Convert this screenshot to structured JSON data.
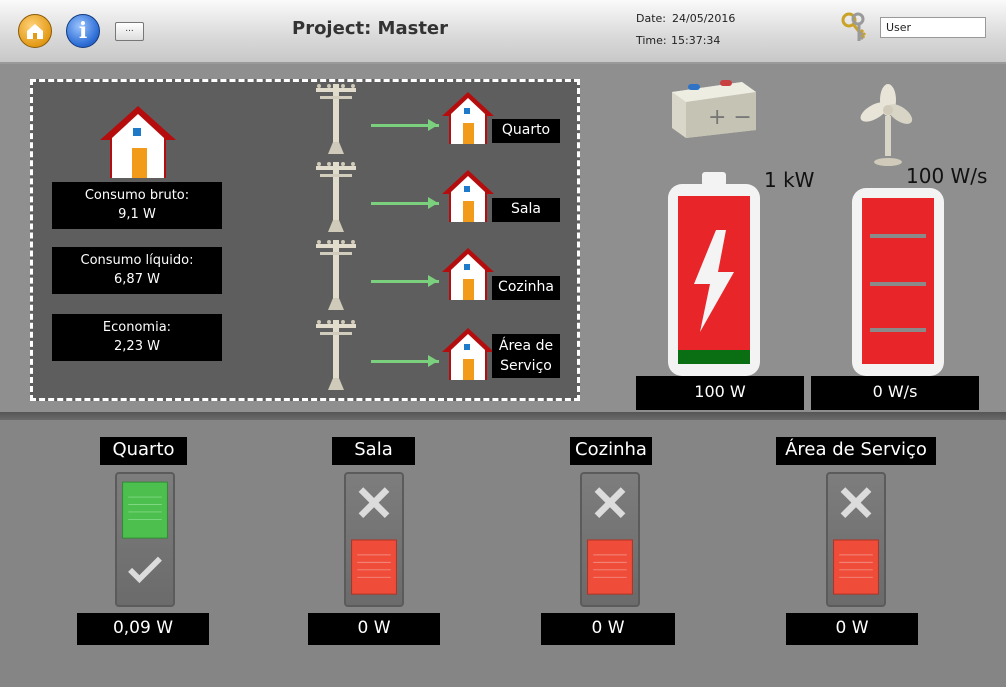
{
  "header": {
    "title": "Project: Master",
    "more_label": "...",
    "info_glyph": "i",
    "date_label": "Date:",
    "date_value": "24/05/2016",
    "time_label": "Time:",
    "time_value": "15:37:34",
    "user_value": "User"
  },
  "summary": [
    {
      "label": "Consumo bruto:",
      "value": "9,1 W"
    },
    {
      "label": "Consumo líquido:",
      "value": "6,87 W"
    },
    {
      "label": "Economia:",
      "value": "2,23 W"
    }
  ],
  "rooms": [
    "Quarto",
    "Sala",
    "Cozinha",
    "Área de Serviço"
  ],
  "room_tags": [
    "Quarto",
    "Sala",
    "Cozinha",
    [
      "Área de",
      "Serviço"
    ]
  ],
  "battery": {
    "capacity": "1 kW",
    "value": "100 W",
    "fill_color": "#e8262a",
    "charge_color": "#0a6e12"
  },
  "fan": {
    "rate": "100 W/s",
    "value": "0 W/s"
  },
  "switches": [
    {
      "room": "Quarto",
      "state": "on",
      "value": "0,09 W"
    },
    {
      "room": "Sala",
      "state": "off",
      "value": "0 W"
    },
    {
      "room": "Cozinha",
      "state": "off",
      "value": "0 W"
    },
    {
      "room": "Área de Serviço",
      "state": "off",
      "value": "0 W"
    }
  ],
  "colors": {
    "on": "#4cbf4e",
    "off": "#ef4c3a",
    "panel_dark": "#5e5e5e"
  },
  "icons": [
    "home-icon",
    "info-icon",
    "keys-icon",
    "house-icon",
    "power-pole-icon",
    "arrow-icon",
    "battery-icon",
    "fan-icon",
    "lightning-icon",
    "check-icon",
    "x-icon"
  ]
}
